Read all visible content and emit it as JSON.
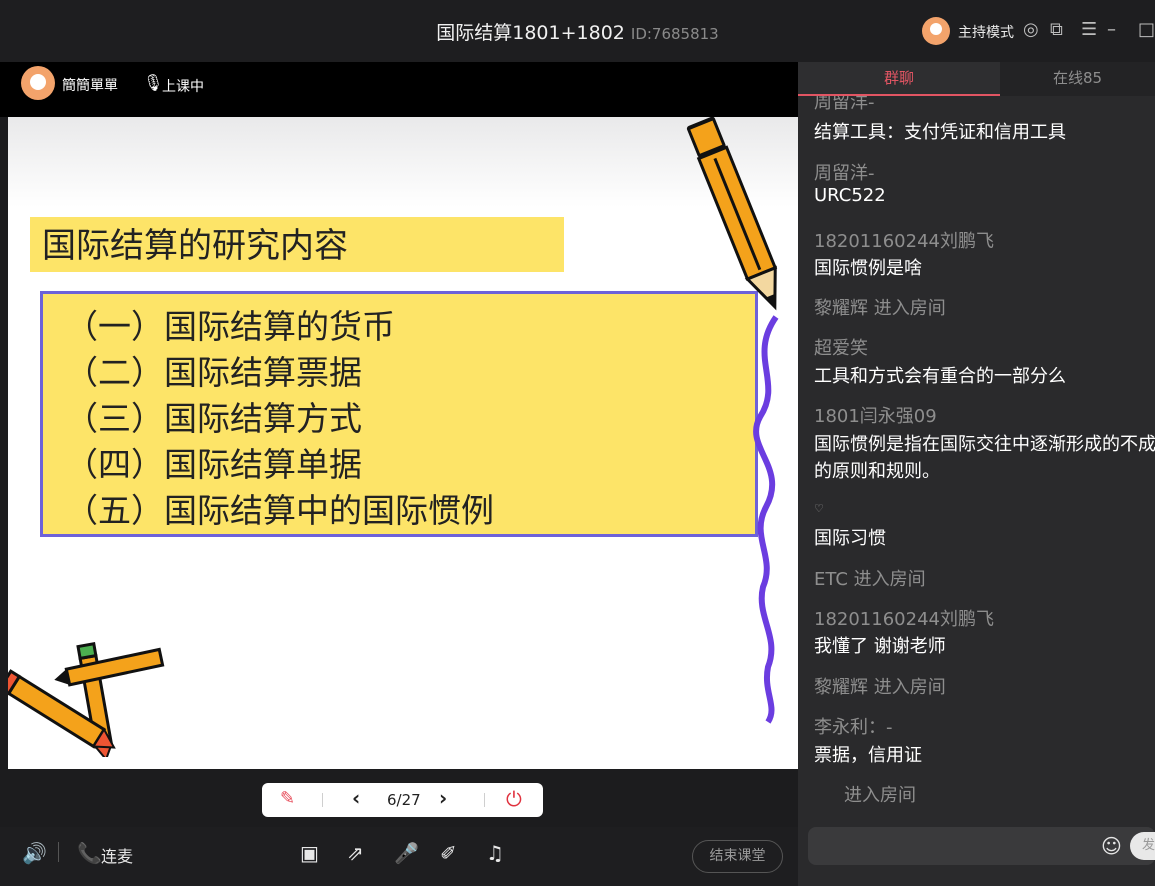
{
  "window": {
    "title": "国际结算1801+1802",
    "room_id": "ID:7685813",
    "mode_label": "主持模式",
    "icons": [
      "target-icon",
      "popout-icon",
      "menu-icon",
      "minimize-icon",
      "maximize-icon"
    ]
  },
  "teacher": {
    "name": "簡簡單單",
    "status": "上课中"
  },
  "slide": {
    "title": "国际结算的研究内容",
    "items": [
      "（一）国际结算的货币",
      "（二）国际结算票据",
      "（三）国际结算方式",
      "（四）国际结算单据",
      "（五）国际结算中的国际惯例"
    ],
    "colors": {
      "box_fill": "#fde468",
      "box_border": "#6d62d9"
    }
  },
  "slide_toolbar": {
    "page": "6/27"
  },
  "bottom_bar": {
    "link_mic_label": "连麦",
    "end_class_label": "结束课堂"
  },
  "chat": {
    "tabs": [
      "群聊",
      "在线85"
    ],
    "accent": "#e25563",
    "messages": [
      {
        "type": "sender",
        "text": "周留洋-"
      },
      {
        "type": "content",
        "text": "结算工具：支付凭证和信用工具"
      },
      {
        "type": "sender",
        "text": "周留洋-"
      },
      {
        "type": "content",
        "text": "URC522"
      },
      {
        "type": "sender",
        "text": "18201160244刘鹏飞"
      },
      {
        "type": "content",
        "text": "国际惯例是啥"
      },
      {
        "type": "sender",
        "text": "黎耀辉 进入房间"
      },
      {
        "type": "sender",
        "text": "超爱笑"
      },
      {
        "type": "content",
        "text": "工具和方式会有重合的一部分么"
      },
      {
        "type": "sender",
        "text": "1801闫永强09"
      },
      {
        "type": "content",
        "text": "国际惯例是指在国际交往中逐渐形成的不成"
      },
      {
        "type": "content",
        "text": "的原则和规则。"
      },
      {
        "type": "sender",
        "text": "♡"
      },
      {
        "type": "content",
        "text": "国际习惯"
      },
      {
        "type": "sender",
        "text": "ETC 进入房间"
      },
      {
        "type": "sender",
        "text": "18201160244刘鹏飞"
      },
      {
        "type": "content",
        "text": "我懂了 谢谢老师"
      },
      {
        "type": "sender",
        "text": "黎耀辉 进入房间"
      },
      {
        "type": "sender",
        "text": "李永利：-"
      },
      {
        "type": "content",
        "text": "票据，信用证"
      },
      {
        "type": "sender",
        "text": "进入房间"
      }
    ],
    "send_label": "发"
  }
}
